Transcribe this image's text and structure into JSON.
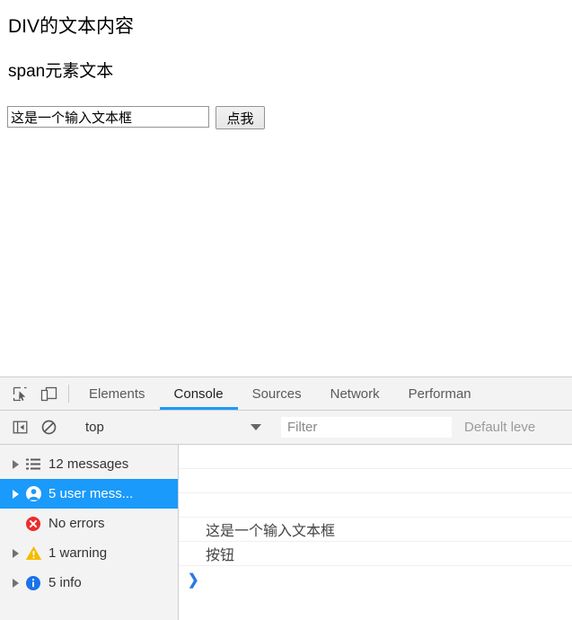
{
  "page": {
    "div_text": "DIV的文本内容",
    "span_text": "span元素文本",
    "input_value": "这是一个输入文本框",
    "input_placeholder": "",
    "button_label": "点我"
  },
  "devtools": {
    "toolbar": {
      "inspect_icon": "inspect-element-icon",
      "device_icon": "device-toolbar-icon"
    },
    "tabs": [
      {
        "label": "Elements",
        "active": false
      },
      {
        "label": "Console",
        "active": true
      },
      {
        "label": "Sources",
        "active": false
      },
      {
        "label": "Network",
        "active": false
      },
      {
        "label": "Performan",
        "active": false
      }
    ],
    "accent_color": "#1a9afa",
    "filter_bar": {
      "sidebar_toggle_icon": "show-console-sidebar-icon",
      "clear_icon": "clear-console-icon",
      "context": "top",
      "context_caret": "chevron-down-icon",
      "filter_placeholder": "Filter",
      "filter_value": "",
      "level": "Default leve"
    },
    "sidebar": {
      "items": [
        {
          "label": "12 messages",
          "icon": "list-icon",
          "expandable": true,
          "selected": false,
          "color": "#5a5a5a"
        },
        {
          "label": "5 user mess...",
          "icon": "user-icon",
          "expandable": true,
          "selected": true,
          "color": "#ffffff"
        },
        {
          "label": "No errors",
          "icon": "error-icon",
          "expandable": false,
          "selected": false,
          "color": "#ee2b2b"
        },
        {
          "label": "1 warning",
          "icon": "warning-icon",
          "expandable": true,
          "selected": false,
          "color": "#f5bb00"
        },
        {
          "label": "5 info",
          "icon": "info-icon",
          "expandable": true,
          "selected": false,
          "color": "#1a73e8"
        }
      ]
    },
    "console_rows": [
      {
        "text": ""
      },
      {
        "text": ""
      },
      {
        "text": ""
      },
      {
        "text": "这是一个输入文本框"
      },
      {
        "text": "按钮"
      }
    ],
    "prompt_symbol": "❯"
  }
}
